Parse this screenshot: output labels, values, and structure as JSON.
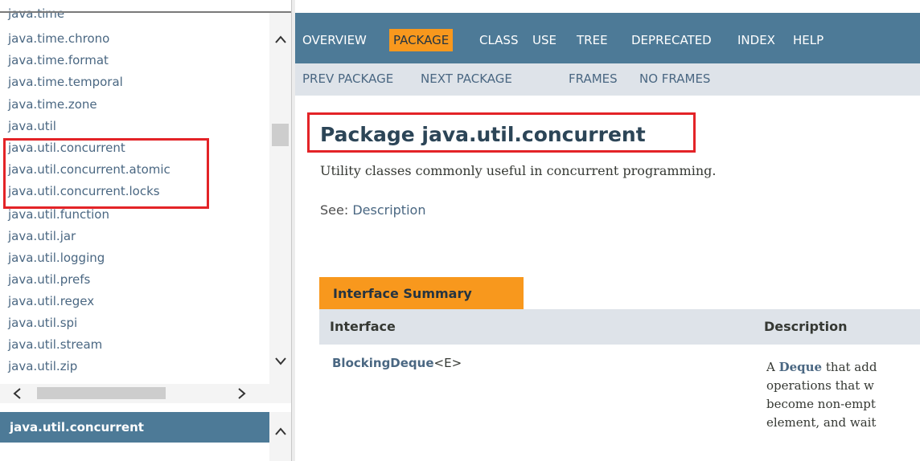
{
  "package_list": {
    "items": [
      "java.time",
      "java.time.chrono",
      "java.time.format",
      "java.time.temporal",
      "java.time.zone",
      "java.util",
      "java.util.concurrent",
      "java.util.concurrent.atomic",
      "java.util.concurrent.locks",
      "java.util.function",
      "java.util.jar",
      "java.util.logging",
      "java.util.prefs",
      "java.util.regex",
      "java.util.spi",
      "java.util.stream",
      "java.util.zip"
    ]
  },
  "classes_frame": {
    "title": "java.util.concurrent"
  },
  "nav": {
    "overview": "OVERVIEW",
    "package": "PACKAGE",
    "class": "CLASS",
    "use": "USE",
    "tree": "TREE",
    "deprecated": "DEPRECATED",
    "index": "INDEX",
    "help": "HELP"
  },
  "subnav": {
    "prev_package": "PREV PACKAGE",
    "next_package": "NEXT PACKAGE",
    "frames": "FRAMES",
    "no_frames": "NO FRAMES"
  },
  "page": {
    "title": "Package java.util.concurrent",
    "description": "Utility classes commonly useful in concurrent programming.",
    "see_label": "See:",
    "see_link": "Description"
  },
  "summary": {
    "tab": "Interface Summary",
    "col_interface": "Interface",
    "col_description": "Description",
    "row": {
      "name": "BlockingDeque",
      "type_param": "<E>",
      "desc_prefix": "A ",
      "desc_link": "Deque",
      "desc_line1_rest": " that add",
      "desc_line2": "operations that w",
      "desc_line3": "become non-empt",
      "desc_line4": "element, and wait"
    }
  },
  "colors": {
    "nav_bar": "#4d7a97",
    "active_tab": "#f8981d",
    "subnav_bar": "#dee3e9",
    "link": "#4a6782",
    "highlight_box": "#e32327"
  }
}
